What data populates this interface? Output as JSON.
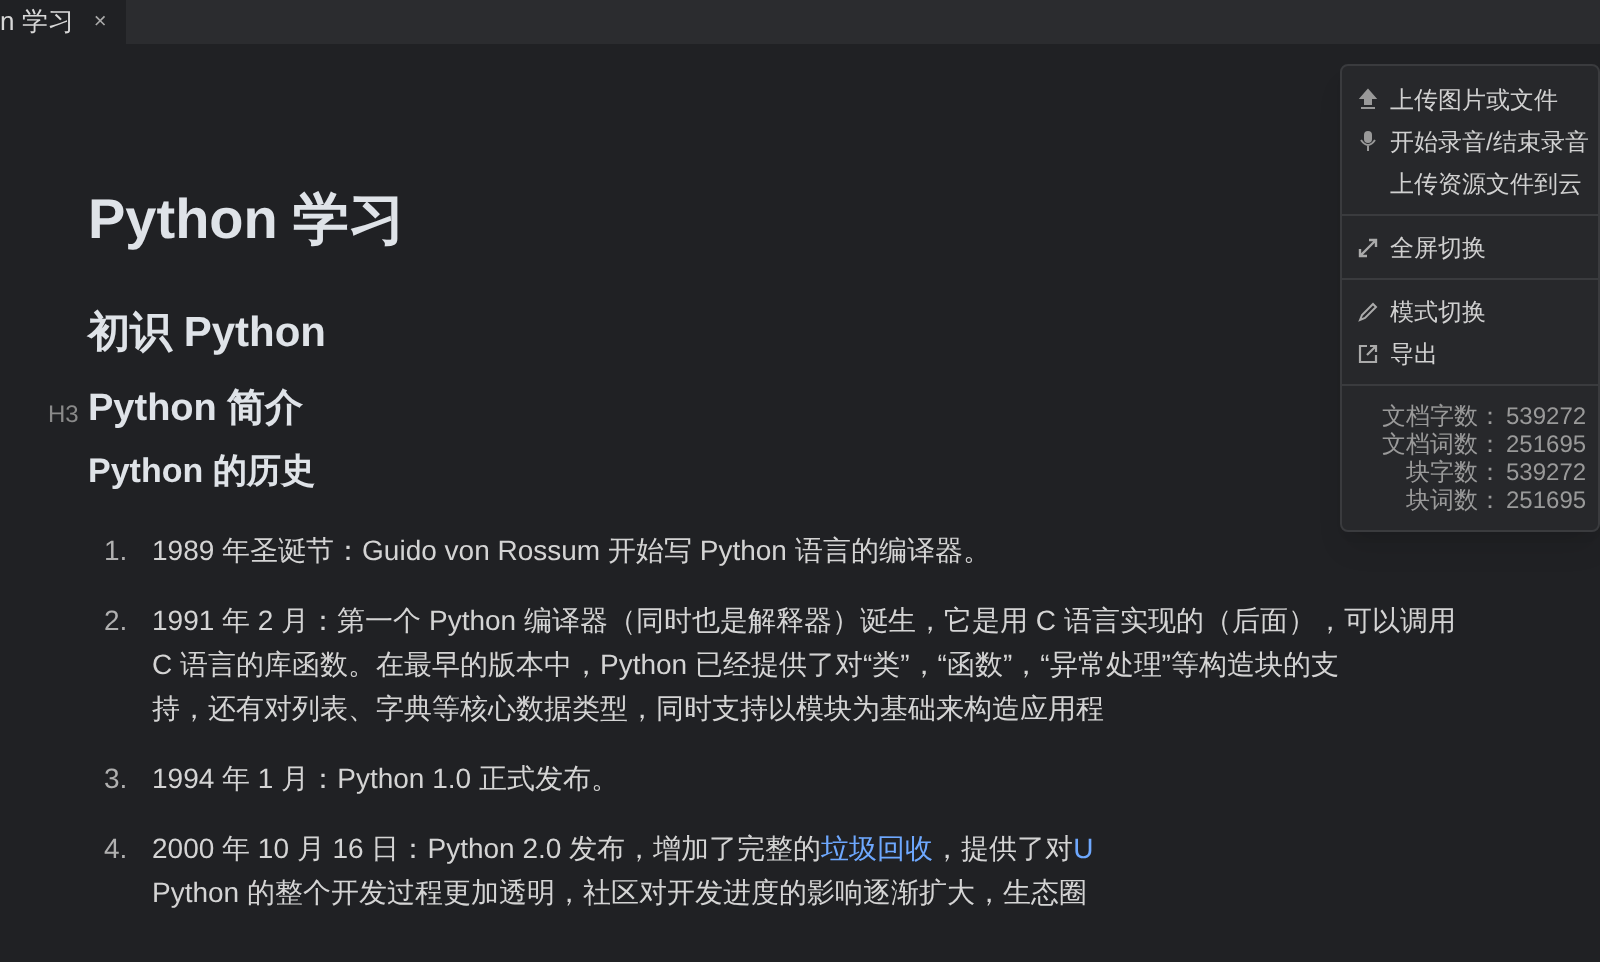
{
  "tabs": [
    {
      "label": "n 学习",
      "close": "×",
      "selected": true
    }
  ],
  "document": {
    "blocks": [
      {
        "kind": "h1",
        "text": "Python 学习"
      },
      {
        "kind": "h2",
        "text": "初识 Python"
      },
      {
        "kind": "h3",
        "text": "Python 简介",
        "marker": "H3"
      },
      {
        "kind": "h4",
        "text": "Python 的历史"
      }
    ],
    "list": [
      {
        "number": "1.",
        "lines": [
          [
            {
              "text": "1989 年圣诞节：Guido von Rossum 开始写 Python 语言的编译器。",
              "link": false
            }
          ]
        ]
      },
      {
        "number": "2.",
        "lines": [
          [
            {
              "text": "1991 年 2 月：第一个 Python 编译器（同时也是解释器）诞生，它是用 C 语言实现的（后面），可以调用",
              "link": false
            }
          ],
          [
            {
              "text": "C 语言的库函数。在最早的版本中，Python 已经提供了对“类”，“函数”，“异常处理”等构造块的支",
              "link": false
            }
          ],
          [
            {
              "text": "持，还有对列表、字典等核心数据类型，同时支持以模块为基础来构造应用程",
              "link": false
            }
          ]
        ]
      },
      {
        "number": "3.",
        "lines": [
          [
            {
              "text": "1994 年 1 月：Python 1.0 正式发布。",
              "link": false
            }
          ]
        ]
      },
      {
        "number": "4.",
        "lines": [
          [
            {
              "text": "2000 年 10 月 16 日：Python 2.0 发布，增加了完整的",
              "link": false
            },
            {
              "text": "垃圾回收",
              "link": true
            },
            {
              "text": "，提供了对",
              "link": false
            },
            {
              "text": "U",
              "link": true
            }
          ],
          [
            {
              "text": "Python 的整个开发过程更加透明，社区对开发进度的影响逐渐扩大，生态圈",
              "link": false
            }
          ]
        ]
      }
    ]
  },
  "menu": {
    "groups": [
      [
        {
          "label": "上传图片或文件"
        },
        {
          "label": "开始录音/结束录音"
        },
        {
          "label": "上传资源文件到云"
        }
      ],
      [
        {
          "label": "全屏切换"
        }
      ],
      [
        {
          "label": "模式切换"
        },
        {
          "label": "导出"
        }
      ]
    ],
    "stats": [
      {
        "label": "文档字数：",
        "value": "539272"
      },
      {
        "label": "文档词数：",
        "value": "251695"
      },
      {
        "label": "块字数：",
        "value": "539272"
      },
      {
        "label": "块词数：",
        "value": "251695"
      }
    ]
  }
}
